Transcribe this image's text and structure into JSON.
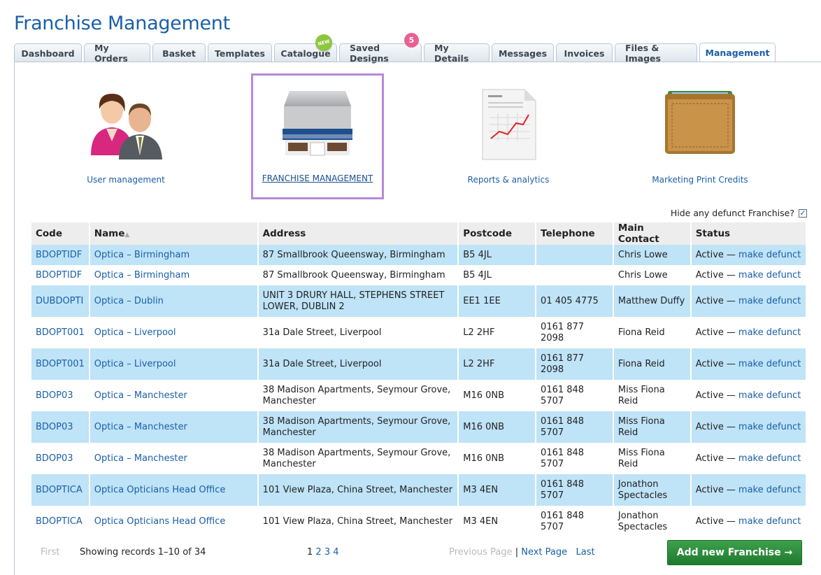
{
  "page": {
    "title": "Franchise Management"
  },
  "tabs": [
    {
      "label": "Dashboard"
    },
    {
      "label": "My Orders"
    },
    {
      "label": "Basket"
    },
    {
      "label": "Templates"
    },
    {
      "label": "Catalogue",
      "badge": "NEW"
    },
    {
      "label": "Saved Designs",
      "badge": "5"
    },
    {
      "label": "My Details"
    },
    {
      "label": "Messages"
    },
    {
      "label": "Invoices"
    },
    {
      "label": "Files & Images"
    },
    {
      "label": "Management"
    }
  ],
  "tiles": [
    {
      "label": "User management",
      "icon": "users-icon"
    },
    {
      "label": "FRANCHISE MANAGEMENT",
      "icon": "storefront-icon"
    },
    {
      "label": "Reports & analytics",
      "icon": "report-icon"
    },
    {
      "label": "Marketing Print Credits",
      "icon": "wallet-icon"
    }
  ],
  "filter": {
    "hide_defunct_label": "Hide any defunct Franchise?",
    "checked_mark": "✓"
  },
  "table": {
    "headers": [
      "Code",
      "Name",
      "Address",
      "Postcode",
      "Telephone",
      "Main Contact",
      "Status"
    ],
    "sort_indicator": "▲",
    "status_separator": "—",
    "make_defunct": "make defunct",
    "rows": [
      {
        "code": "BDOPTIDF",
        "name": "Optica – Birmingham",
        "address": "87 Smallbrook Queensway, Birmingham",
        "postcode": "B5 4JL",
        "telephone": "",
        "contact": "Chris Lowe",
        "status": "Active"
      },
      {
        "code": "BDOPTIDF",
        "name": "Optica – Birmingham",
        "address": "87 Smallbrook Queensway, Birmingham",
        "postcode": "B5 4JL",
        "telephone": "",
        "contact": "Chris Lowe",
        "status": "Active"
      },
      {
        "code": "DUBDOPTI",
        "name": "Optica – Dublin",
        "address": "UNIT 3 DRURY HALL, STEPHENS STREET LOWER, DUBLIN 2",
        "postcode": "EE1 1EE",
        "telephone": "01 405 4775",
        "contact": "Matthew Duffy",
        "status": "Active"
      },
      {
        "code": "BDOPT001",
        "name": "Optica – Liverpool",
        "address": "31a Dale Street, Liverpool",
        "postcode": "L2 2HF",
        "telephone": "0161 877 2098",
        "contact": "Fiona Reid",
        "status": "Active"
      },
      {
        "code": "BDOPT001",
        "name": "Optica – Liverpool",
        "address": "31a Dale Street, Liverpool",
        "postcode": "L2 2HF",
        "telephone": "0161 877 2098",
        "contact": "Fiona Reid",
        "status": "Active"
      },
      {
        "code": "BDOP03",
        "name": "Optica – Manchester",
        "address": "38 Madison Apartments, Seymour Grove, Manchester",
        "postcode": "M16 0NB",
        "telephone": "0161 848 5707",
        "contact": "Miss Fiona Reid",
        "status": "Active"
      },
      {
        "code": "BDOP03",
        "name": "Optica – Manchester",
        "address": "38 Madison Apartments, Seymour Grove, Manchester",
        "postcode": "M16 0NB",
        "telephone": "0161 848 5707",
        "contact": "Miss Fiona Reid",
        "status": "Active"
      },
      {
        "code": "BDOP03",
        "name": "Optica – Manchester",
        "address": "38 Madison Apartments, Seymour Grove, Manchester",
        "postcode": "M16 0NB",
        "telephone": "0161 848 5707",
        "contact": "Miss Fiona Reid",
        "status": "Active"
      },
      {
        "code": "BDOPTICA",
        "name": "Optica Opticians Head Office",
        "address": "101 View Plaza, China Street, Manchester",
        "postcode": "M3 4EN",
        "telephone": "0161 848 5707",
        "contact": "Jonathon Spectacles",
        "status": "Active"
      },
      {
        "code": "BDOPTICA",
        "name": "Optica Opticians Head Office",
        "address": "101 View Plaza, China Street, Manchester",
        "postcode": "M3 4EN",
        "telephone": "0161 848 5707",
        "contact": "Jonathon Spectacles",
        "status": "Active"
      }
    ]
  },
  "pager": {
    "first": "First",
    "showing": "Showing records 1–10 of 34",
    "current_page": "1",
    "pages": [
      "2",
      "3",
      "4"
    ],
    "previous": "Previous Page",
    "separator": "|",
    "next": "Next Page",
    "last": "Last"
  },
  "add_button": {
    "label": "Add new Franchise →"
  },
  "colors": {
    "brand_blue": "#1a5fa8",
    "row_highlight": "#bfe3f7",
    "selected_border": "#b889d6",
    "add_green": "#2e8b3c"
  }
}
